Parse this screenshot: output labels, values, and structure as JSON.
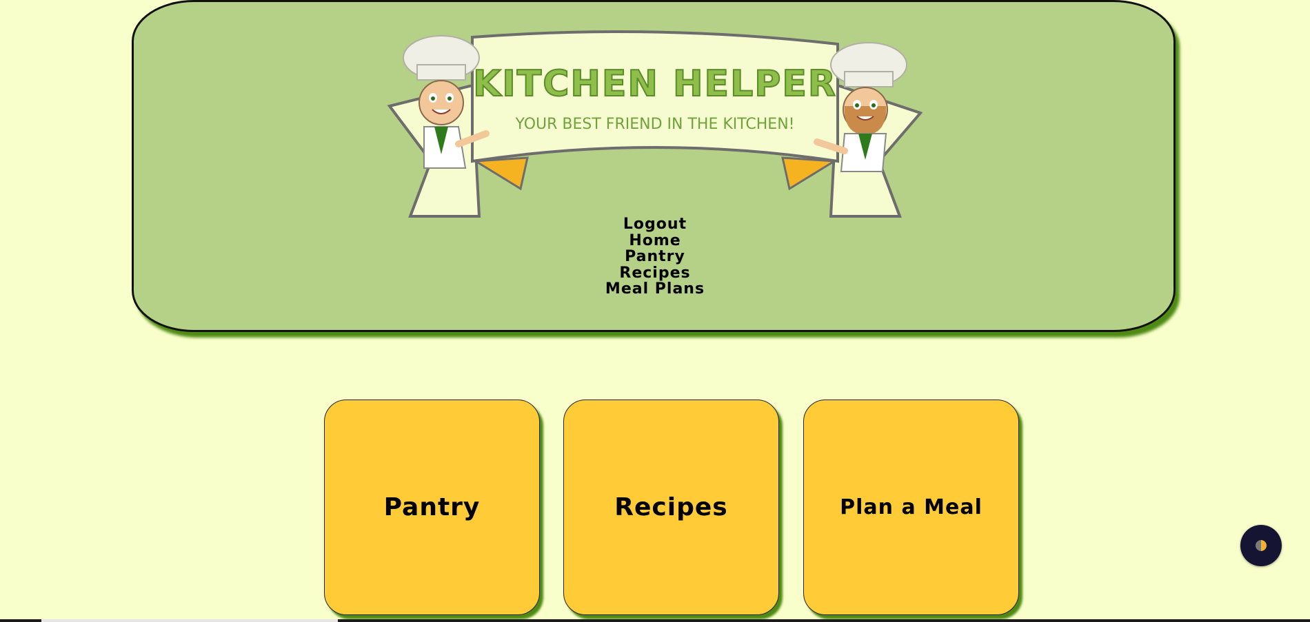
{
  "logo": {
    "title": "KITCHEN HELPER",
    "subtitle": "YOUR BEST FRIEND IN THE KITCHEN!"
  },
  "nav": {
    "items": [
      {
        "label": "Logout"
      },
      {
        "label": "Home"
      },
      {
        "label": "Pantry"
      },
      {
        "label": "Recipes"
      },
      {
        "label": "Meal Plans"
      }
    ]
  },
  "cards": [
    {
      "label": "Pantry"
    },
    {
      "label": "Recipes"
    },
    {
      "label": "Plan a Meal"
    }
  ],
  "colors": {
    "page_background": "#f9ffcb",
    "header_background": "#b5d187",
    "card_background": "#ffcb36",
    "header_shadow": "#4f8a14",
    "theme_button": "#151533"
  },
  "icons": {
    "theme_toggle": "half-moon-contrast-icon",
    "chef_left": "chef-mascot-icon",
    "chef_right": "chef-mascot-icon"
  }
}
